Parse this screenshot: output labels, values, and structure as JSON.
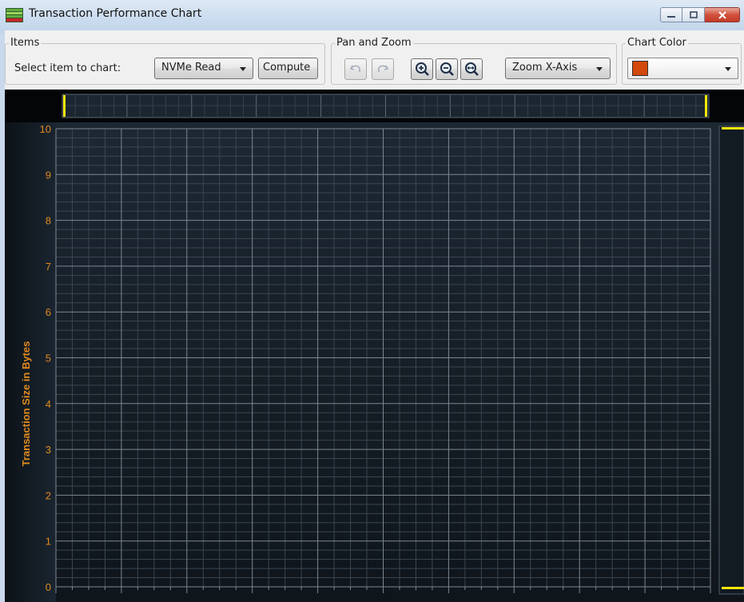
{
  "window": {
    "title": "Transaction Performance Chart"
  },
  "toolbar": {
    "items_group": {
      "title": "Items",
      "select_label": "Select item to chart:",
      "item_selected": "NVMe Read",
      "compute_label": "Compute"
    },
    "panzoom_group": {
      "title": "Pan and Zoom",
      "zoom_mode_selected": "Zoom X-Axis",
      "buttons": [
        "undo-icon",
        "redo-icon",
        "zoom-in-icon",
        "zoom-out-icon",
        "zoom-fit-icon"
      ]
    },
    "chartcolor_group": {
      "title": "Chart Color",
      "selected_color": "#d2480d"
    }
  },
  "colors": {
    "chart_background": "#16202a",
    "grid_major": "#7d8792",
    "grid_minor": "#3a4652",
    "axis_text": "#e08a1e",
    "scrollbar_marker": "#f4e50a"
  },
  "chart_data": {
    "type": "line",
    "ylabel": "Transaction Size in Bytes",
    "xlabel": "",
    "ylim": [
      0,
      10
    ],
    "y_ticks": [
      "0",
      "1",
      "2",
      "3",
      "4",
      "5",
      "6",
      "7",
      "8",
      "9",
      "10"
    ],
    "x_ticks": [],
    "series": [],
    "grid": true
  }
}
